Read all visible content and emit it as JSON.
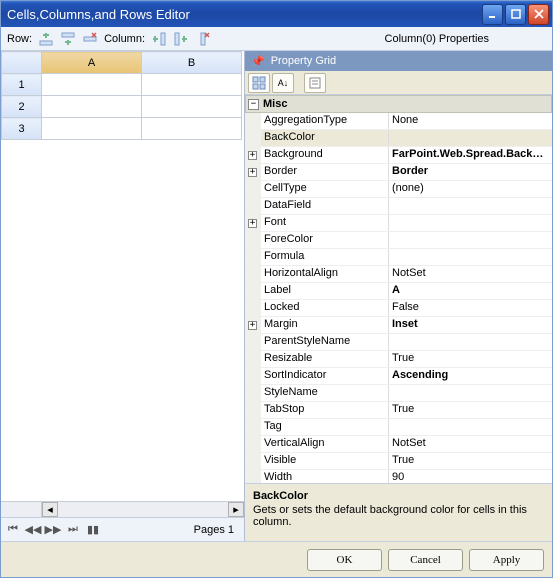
{
  "titlebar": {
    "title": "Cells,Columns,and Rows Editor"
  },
  "toolbar": {
    "row_label": "Row:",
    "column_label": "Column:",
    "right_label": "Column(0) Properties"
  },
  "sheet": {
    "columns": [
      "A",
      "B"
    ],
    "row_headers": [
      "1",
      "2",
      "3"
    ],
    "selected_column_index": 0
  },
  "navbar": {
    "pages_label": "Pages 1"
  },
  "property_grid": {
    "header": "Property Grid",
    "category": "Misc",
    "selected_index": 1,
    "props": [
      {
        "name": "AggregationType",
        "value": "None",
        "bold": false,
        "expandable": false
      },
      {
        "name": "BackColor",
        "value": "",
        "bold": false,
        "expandable": false
      },
      {
        "name": "Background",
        "value": "FarPoint.Web.Spread.Background",
        "bold": true,
        "expandable": true
      },
      {
        "name": "Border",
        "value": "Border",
        "bold": true,
        "expandable": true
      },
      {
        "name": "CellType",
        "value": "(none)",
        "bold": false,
        "expandable": false
      },
      {
        "name": "DataField",
        "value": "",
        "bold": false,
        "expandable": false
      },
      {
        "name": "Font",
        "value": "",
        "bold": false,
        "expandable": true
      },
      {
        "name": "ForeColor",
        "value": "",
        "bold": false,
        "expandable": false
      },
      {
        "name": "Formula",
        "value": "",
        "bold": false,
        "expandable": false
      },
      {
        "name": "HorizontalAlign",
        "value": "NotSet",
        "bold": false,
        "expandable": false
      },
      {
        "name": "Label",
        "value": "A",
        "bold": true,
        "expandable": false
      },
      {
        "name": "Locked",
        "value": "False",
        "bold": false,
        "expandable": false
      },
      {
        "name": "Margin",
        "value": "Inset",
        "bold": true,
        "expandable": true
      },
      {
        "name": "ParentStyleName",
        "value": "",
        "bold": false,
        "expandable": false
      },
      {
        "name": "Resizable",
        "value": "True",
        "bold": false,
        "expandable": false
      },
      {
        "name": "SortIndicator",
        "value": "Ascending",
        "bold": true,
        "expandable": false
      },
      {
        "name": "StyleName",
        "value": "",
        "bold": false,
        "expandable": false
      },
      {
        "name": "TabStop",
        "value": "True",
        "bold": false,
        "expandable": false
      },
      {
        "name": "Tag",
        "value": "",
        "bold": false,
        "expandable": false
      },
      {
        "name": "VerticalAlign",
        "value": "NotSet",
        "bold": false,
        "expandable": false
      },
      {
        "name": "Visible",
        "value": "True",
        "bold": false,
        "expandable": false
      },
      {
        "name": "Width",
        "value": "90",
        "bold": false,
        "expandable": false
      }
    ]
  },
  "help": {
    "name": "BackColor",
    "desc": "Gets or sets the default background color for cells in this column."
  },
  "buttons": {
    "ok": "OK",
    "cancel": "Cancel",
    "apply": "Apply"
  }
}
